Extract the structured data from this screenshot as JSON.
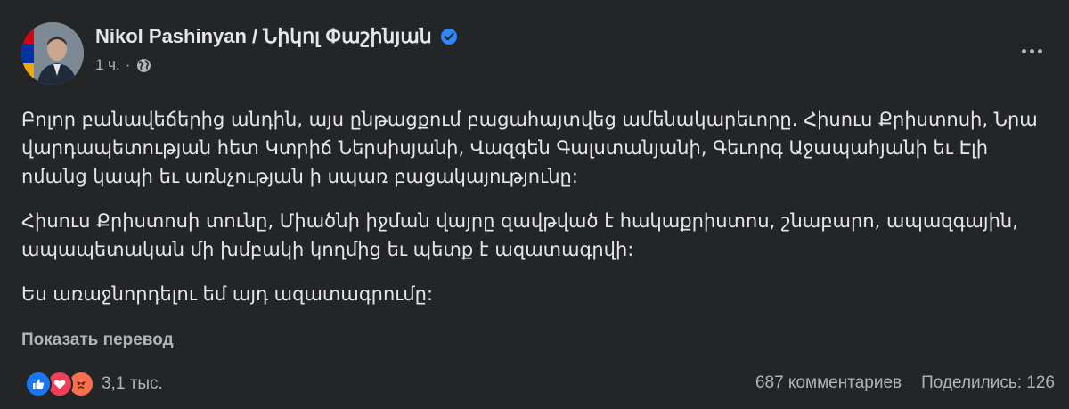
{
  "header": {
    "author": "Nikol Pashinyan / Նիկոլ Փաշինյան",
    "time": "1 ч.",
    "separator": "·"
  },
  "icons": {
    "verified": "verified-badge-icon",
    "privacy": "globe-icon",
    "more": "more-options-icon",
    "reactions": [
      "like-icon",
      "love-icon",
      "angry-icon"
    ]
  },
  "colors": {
    "background": "#242526",
    "text": "#e4e6eb",
    "secondary": "#b0b3b8",
    "verified": "#2d88ff",
    "like": "#1877f2",
    "love": "#f33e58",
    "angry": "#f7714c"
  },
  "post": {
    "paragraphs": [
      "Բոլոր բանավեճերից անդին, այս ընթացքում բացահայտվեց ամենակարեւորը. Հիսուս Քրիստոսի, Նրա վարդապետության հետ Կտրիճ Ներսիսյանի, Վազգեն Գալստանյանի, Գեւորգ Աջապահյանի եւ Էլի ոմանց կապի եւ առնչության ի սպառ բացակայությունը:",
      "Հիսուս Քրիստոսի տունը, Միածնի իջման վայրը զավթված է հակաքրիստոս, շնաբարո, ապազգային, ապապետական մի խմբակի կողմից եւ պետք է ազատագրվի:",
      "Ես առաջնորդելու եմ այդ ազատագրումը:"
    ],
    "translate_link": "Показать перевод"
  },
  "footer": {
    "reactions_count": "3,1 тыс.",
    "comments": "687 комментариев",
    "shares": "Поделились: 126"
  }
}
